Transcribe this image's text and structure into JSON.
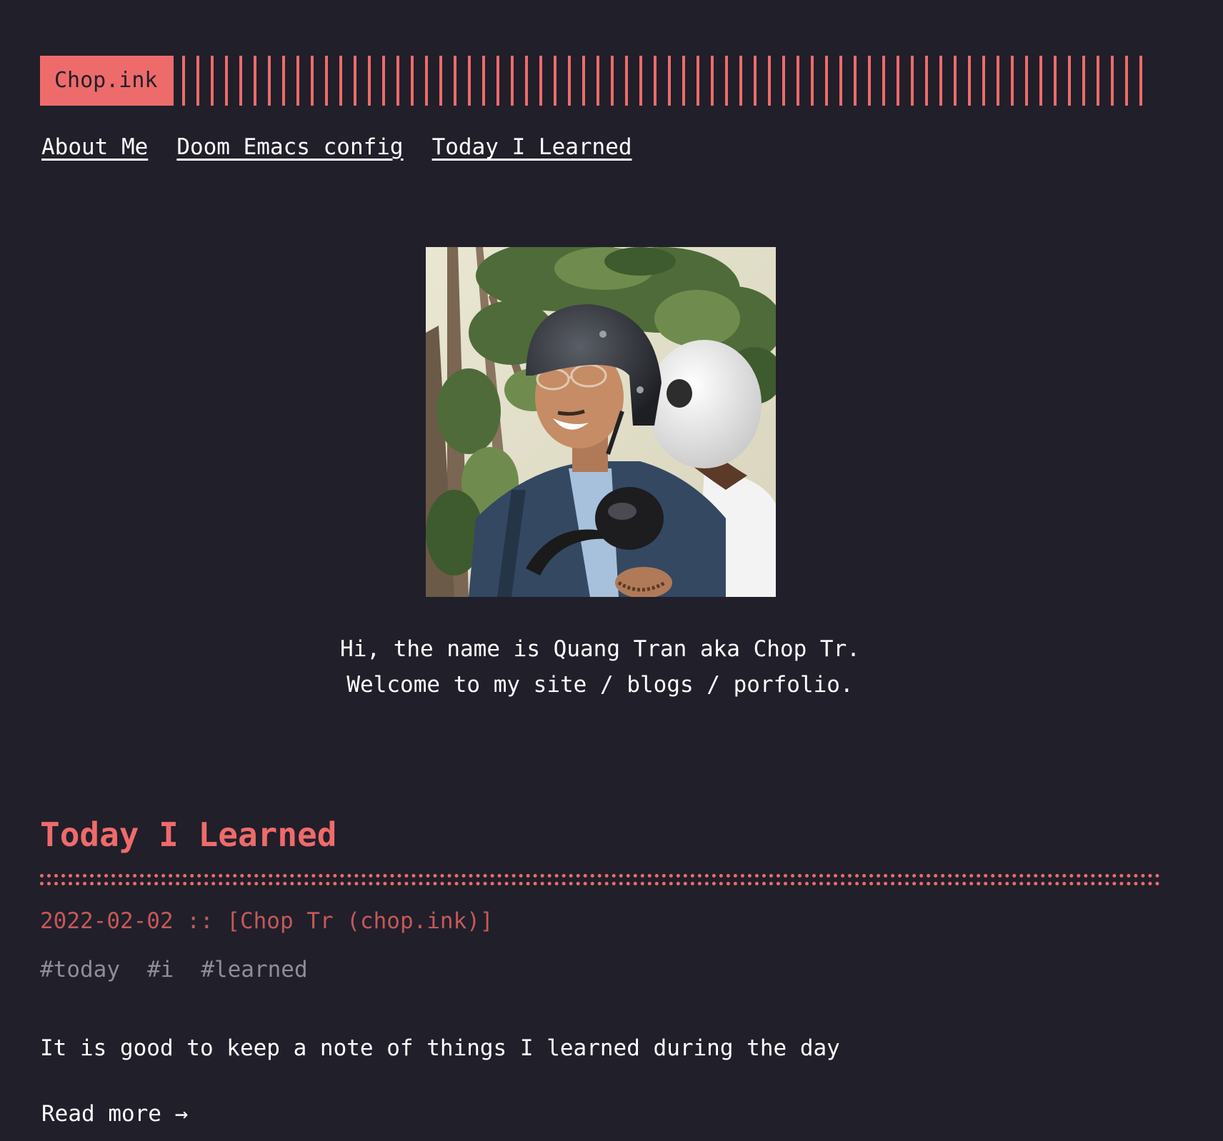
{
  "header": {
    "logo_text": "Chop.ink"
  },
  "nav": {
    "items": [
      {
        "label": "About Me"
      },
      {
        "label": "Doom Emacs config"
      },
      {
        "label": "Today I Learned"
      }
    ]
  },
  "intro": {
    "line1": "Hi, the name is Quang Tran aka Chop Tr.",
    "line2": "Welcome to my site / blogs / porfolio."
  },
  "post": {
    "title": "Today I Learned",
    "date": "2022-02-02",
    "separator": "::",
    "author": "[Chop Tr (chop.ink)]",
    "tags": [
      "#today",
      "#i",
      "#learned"
    ],
    "excerpt": "It is good to keep a note of things I learned during the day",
    "read_more": "Read more →"
  },
  "colors": {
    "background": "#211f2a",
    "accent": "#ee6b6b",
    "text": "#ffffff",
    "meta": "#c45959",
    "muted": "#8f8d96"
  }
}
